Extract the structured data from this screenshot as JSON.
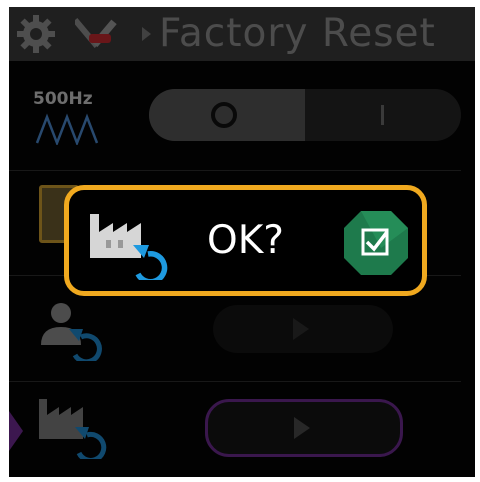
{
  "header": {
    "title": "Factory Reset",
    "icons": [
      "gear-icon",
      "tools-icon"
    ]
  },
  "tone": {
    "frequency_label": "500Hz",
    "wave_icon": "waveform-icon"
  },
  "toggle": {
    "off_symbol": "O",
    "on_symbol": "I",
    "selected": "off"
  },
  "dialog": {
    "message": "OK?",
    "icon": "factory-reset-icon",
    "confirm_icon": "checkbox-checked-icon"
  },
  "colors": {
    "dialog_border": "#f0a91f",
    "confirm_green": "#1e7a4c",
    "selection_purple": "#6a2a8c"
  }
}
